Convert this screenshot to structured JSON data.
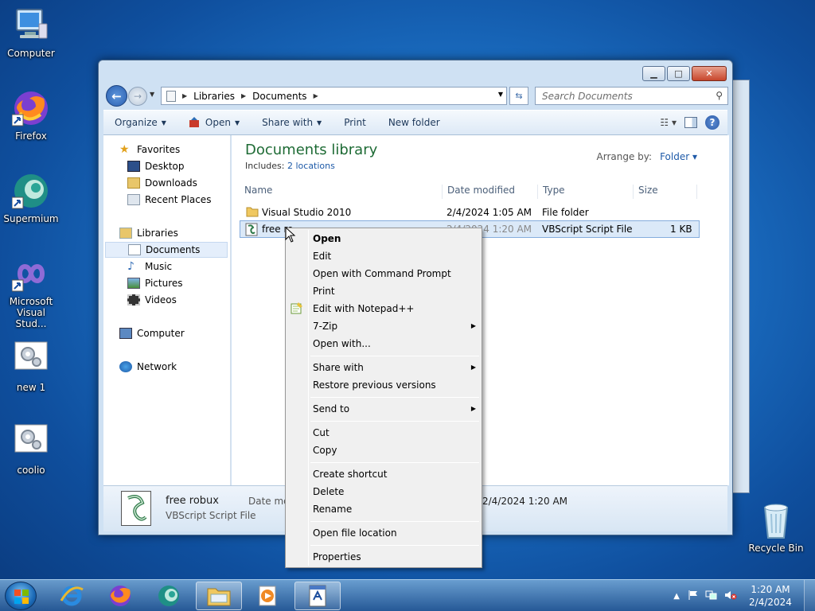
{
  "desktop": {
    "icons": [
      {
        "label": "Computer",
        "icon": "computer-icon"
      },
      {
        "label": "Firefox",
        "icon": "firefox-icon"
      },
      {
        "label": "Supermium",
        "icon": "supermium-icon"
      },
      {
        "label": "Microsoft Visual Stud...",
        "icon": "visual-studio-icon"
      },
      {
        "label": "new 1",
        "icon": "script-file-icon"
      },
      {
        "label": "coolio",
        "icon": "script-file-icon"
      },
      {
        "label": "Recycle Bin",
        "icon": "recycle-bin-icon"
      }
    ]
  },
  "explorer": {
    "title_buttons": {
      "minimize": "▁",
      "maximize": "□",
      "close": "✕"
    },
    "breadcrumb": [
      "Libraries",
      "Documents"
    ],
    "search_placeholder": "Search Documents",
    "toolbar": {
      "organize": "Organize",
      "open": "Open",
      "share_with": "Share with",
      "print": "Print",
      "new_folder": "New folder"
    },
    "nav": {
      "favorites": "Favorites",
      "desktop": "Desktop",
      "downloads": "Downloads",
      "recent_places": "Recent Places",
      "libraries": "Libraries",
      "documents": "Documents",
      "music": "Music",
      "pictures": "Pictures",
      "videos": "Videos",
      "computer": "Computer",
      "network": "Network"
    },
    "library_title": "Documents library",
    "includes_label": "Includes:",
    "includes_link": "2 locations",
    "arrange_label": "Arrange by:",
    "arrange_value": "Folder",
    "columns": [
      "Name",
      "Date modified",
      "Type",
      "Size"
    ],
    "files": [
      {
        "name": "Visual Studio 2010",
        "date": "2/4/2024 1:05 AM",
        "type": "File folder",
        "size": ""
      },
      {
        "name": "free ro",
        "date": "2/4/2024 1:20 AM",
        "type": "VBScript Script File",
        "size": "1 KB"
      }
    ],
    "details": {
      "name": "free robux",
      "type": "VBScript Script File",
      "date_label": "Date mod",
      "date_value": "2/4/2024 1:20 AM"
    }
  },
  "context_menu": {
    "items": [
      "Open",
      "Edit",
      "Open with Command Prompt",
      "Print",
      "Edit with Notepad++",
      "7-Zip",
      "Open with...",
      "Share with",
      "Restore previous versions",
      "Send to",
      "Cut",
      "Copy",
      "Create shortcut",
      "Delete",
      "Rename",
      "Open file location",
      "Properties"
    ],
    "submenu_arrow": "▶"
  },
  "taskbar": {
    "time": "1:20 AM",
    "date": "2/4/2024"
  },
  "colors": {
    "library_title": "#1e6b35",
    "link": "#1e5aa8",
    "selection": "#dbe9f8"
  }
}
